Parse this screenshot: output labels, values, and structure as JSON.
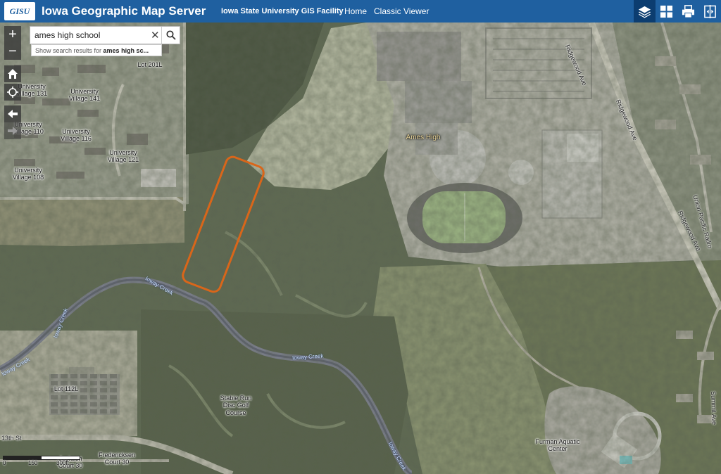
{
  "header": {
    "logo_text": "GISU",
    "title": "Iowa Geographic Map Server",
    "facility": "Iowa State University GIS Facility",
    "nav": [
      "Home",
      "Classic Viewer"
    ],
    "tools": [
      "layers-icon",
      "grid-icon",
      "print-icon",
      "swipe-icon"
    ],
    "bg_color": "#1f60a0"
  },
  "search": {
    "value": "ames high school",
    "suggestion_prefix": "Show search results for ",
    "suggestion_term": "ames high sc..."
  },
  "controls": {
    "zoom_in": "+",
    "zoom_out": "−"
  },
  "map": {
    "labels": {
      "lot_201l": "Lot 201L",
      "uv_131": "University\nVillage 131",
      "uv_141": "University\nVillage 141",
      "uv_110": "University\nVillage 110",
      "uv_116": "University\nVillage 116",
      "uv_121": "University\nVillage 121",
      "uv_108": "University\nVillage 108",
      "ames_high": "Ames High",
      "lot_112l": "Lot 112L",
      "stable_run": "Stable Run\nDisc Golf\nCourse",
      "furman": "Furman Aquatic\nCenter",
      "fredericksen": "Fredericksen\nCourt 30",
      "jackson": "Jackson\nCourt 30"
    },
    "roads": {
      "ridgewood_1": "Ridgewood Ave",
      "ridgewood_2": "Ridgewood Ave",
      "ridgewood_3": "Ridgewood Ave",
      "union_pacific": "Union Pacific Railro",
      "summit": "Summit Ave",
      "thirteenth": "13th St"
    },
    "creeks": {
      "c1": "Ioway Creek",
      "c2": "Ioway Creek",
      "c3": "Ioway Creek",
      "c4": "Ioway Creek",
      "c5": "Ioway Creek"
    },
    "highlight_color": "#d9661a"
  },
  "scalebar": {
    "tick0": "0",
    "tick1": "150",
    "tick2": "300ft"
  }
}
